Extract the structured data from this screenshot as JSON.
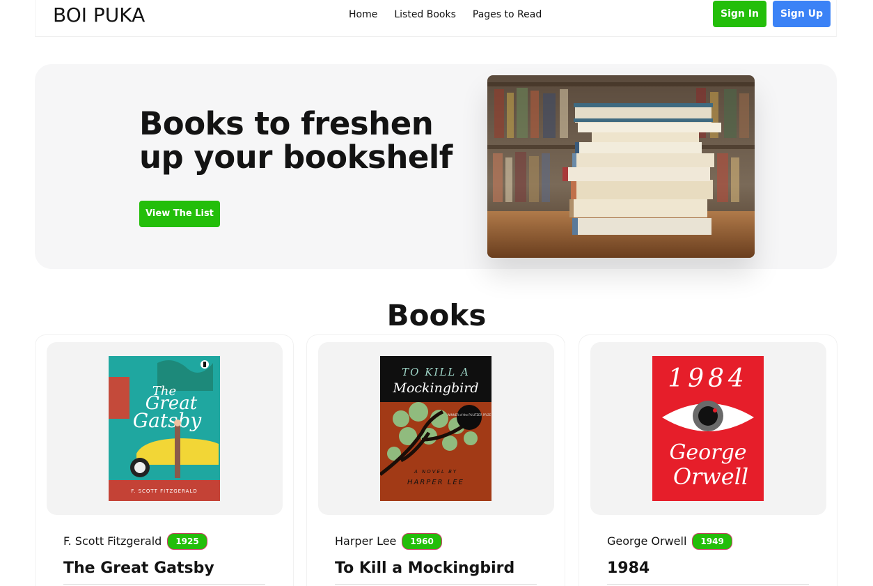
{
  "navbar": {
    "brand": "BOI PUKA",
    "links": [
      "Home",
      "Listed Books",
      "Pages to Read"
    ],
    "sign_in": "Sign In",
    "sign_up": "Sign Up"
  },
  "hero": {
    "title": "Books to freshen up your bookshelf",
    "button": "View The List"
  },
  "books_section": {
    "title": "Books",
    "books": [
      {
        "author": "F. Scott Fitzgerald",
        "year": "1925",
        "title": "The Great Gatsby",
        "cover": {
          "title_line1": "The",
          "title_line2": "Great",
          "title_line3": "Gatsby",
          "author_line": "F. SCOTT FITZGERALD"
        }
      },
      {
        "author": "Harper Lee",
        "year": "1960",
        "title": "To Kill a Mockingbird",
        "cover": {
          "title_line1": "TO KILL A",
          "title_line2": "Mockingbird",
          "badge": "WINNER of the PULITZER PRIZE",
          "novel_line": "A NOVEL BY",
          "author_line": "HARPER LEE"
        }
      },
      {
        "author": "George Orwell",
        "year": "1949",
        "title": "1984",
        "cover": {
          "title_line1": "1984",
          "author_line1": "George",
          "author_line2": "Orwell"
        }
      }
    ]
  },
  "colors": {
    "green": "#23be0a",
    "blue": "#3b82f6",
    "hero_bg": "#f6f6f7"
  }
}
